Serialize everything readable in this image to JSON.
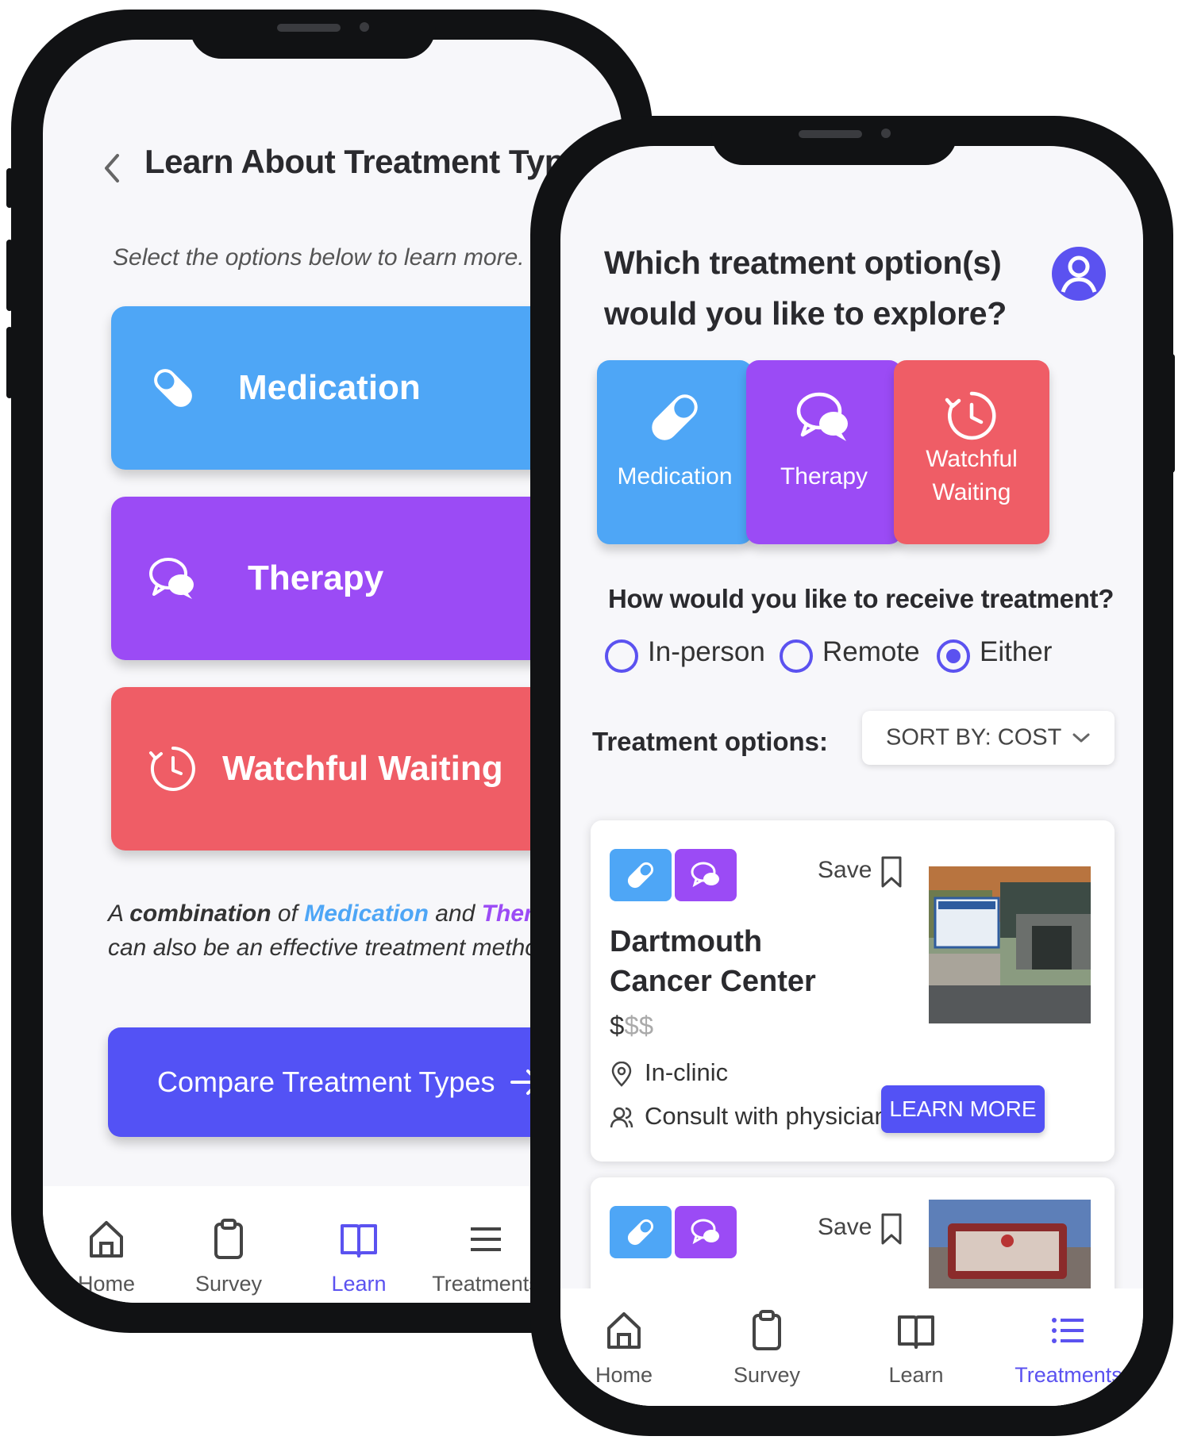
{
  "learn_screen": {
    "title": "Learn About Treatment Types",
    "subtitle": "Select the options below to learn more.",
    "cards": [
      {
        "label": "Medication",
        "color": "#4ea6f6",
        "icon": "pill-icon"
      },
      {
        "label": "Therapy",
        "color": "#9b4bf5",
        "icon": "chat-bubbles-icon"
      },
      {
        "label": "Watchful Waiting",
        "color": "#ef5d66",
        "icon": "clock-icon"
      }
    ],
    "combo_note": {
      "prefix": "A ",
      "combination": "combination",
      "of": " of ",
      "medication": "Medication",
      "and": " and ",
      "therapy": "Therapy",
      "line2": "can also be an effective treatment method."
    },
    "compare_button": "Compare Treatment Types",
    "tabs": [
      {
        "label": "Home",
        "icon": "home-icon"
      },
      {
        "label": "Survey",
        "icon": "clipboard-icon"
      },
      {
        "label": "Learn",
        "icon": "book-icon"
      },
      {
        "label": "Treatments",
        "icon": "list-icon"
      }
    ],
    "active_tab": "Learn"
  },
  "explore_screen": {
    "question": "Which treatment option(s) would you like to explore?",
    "tiles": [
      {
        "label": "Medication",
        "color": "#4ea6f6",
        "icon": "pill-icon"
      },
      {
        "label": "Therapy",
        "color": "#9b4bf5",
        "icon": "chat-bubbles-icon"
      },
      {
        "label": "Watchful Waiting",
        "color": "#ef5d66",
        "icon": "clock-icon"
      }
    ],
    "receive_question": "How would you like to receive treatment?",
    "receive_options": [
      "In-person",
      "Remote",
      "Either"
    ],
    "receive_selected": "Either",
    "options_label": "Treatment options:",
    "sort_label": "SORT BY: COST",
    "results": [
      {
        "name": "Dartmouth Cancer Center",
        "save_label": "Save",
        "cost_active": "$",
        "cost_inactive": "$$",
        "location": "In-clinic",
        "consult": "Consult with physician",
        "button": "LEARN MORE",
        "types": [
          "Medication",
          "Therapy"
        ]
      },
      {
        "save_label": "Save",
        "types": [
          "Medication",
          "Therapy"
        ]
      }
    ],
    "tabs": [
      {
        "label": "Home",
        "icon": "home-icon"
      },
      {
        "label": "Survey",
        "icon": "clipboard-icon"
      },
      {
        "label": "Learn",
        "icon": "book-icon"
      },
      {
        "label": "Treatments",
        "icon": "list-icon"
      }
    ],
    "active_tab": "Treatments",
    "accent": "#5b52f0"
  }
}
